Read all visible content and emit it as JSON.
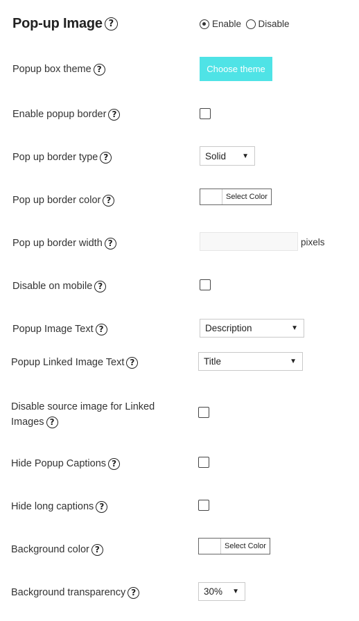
{
  "header": {
    "title": "Pop-up Image",
    "enable_label": "Enable",
    "disable_label": "Disable",
    "selected": "enable"
  },
  "help_glyph": "?",
  "rows": {
    "theme": {
      "label": "Popup box theme",
      "button": "Choose theme"
    },
    "enable_border": {
      "label": "Enable popup border"
    },
    "border_type": {
      "label": "Pop up border type",
      "value": "Solid"
    },
    "border_color": {
      "label": "Pop up border color",
      "button": "Select Color"
    },
    "border_width": {
      "label": "Pop up border width",
      "unit": "pixels",
      "value": ""
    },
    "disable_mobile": {
      "label": "Disable on mobile"
    },
    "image_text": {
      "label": "Popup Image Text",
      "value": "Description"
    },
    "linked_text": {
      "label": "Popup Linked Image Text",
      "value": "Title"
    },
    "disable_source": {
      "label_line1": "Disable source image for Linked",
      "label_line2": "Images"
    },
    "hide_captions": {
      "label": "Hide Popup Captions"
    },
    "hide_long": {
      "label": "Hide long captions"
    },
    "bg_color": {
      "label": "Background color",
      "button": "Select Color"
    },
    "bg_transparency": {
      "label": "Background transparency",
      "value": "30%"
    }
  },
  "dropdown_arrow": "▼",
  "colors": {
    "accent": "#4fe3e6",
    "text": "#333333"
  }
}
